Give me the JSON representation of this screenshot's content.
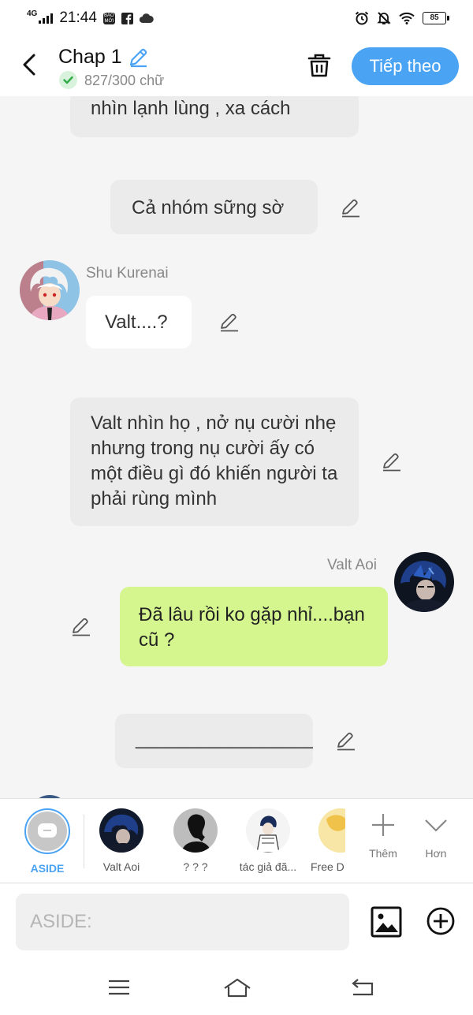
{
  "status_bar": {
    "network": "4G",
    "time": "21:44",
    "app_badge": "BÁO MỚI",
    "battery": "85"
  },
  "header": {
    "title": "Chap 1",
    "word_count": "827/300 chữ",
    "next_label": "Tiếp theo"
  },
  "messages": {
    "narration_1": "nhìn lạnh lùng , xa cách",
    "narration_2": "Cả nhóm sững sờ",
    "shu_name": "Shu Kurenai",
    "shu_text": "Valt....?",
    "narration_3": "Valt nhìn họ , nở nụ cười nhẹ nhưng trong nụ cười ấy có một điều gì đó khiến người ta phải rùng mình",
    "valt_name": "Valt Aoi",
    "valt_text": "Đã lâu rồi ko gặp nhỉ....bạn cũ ?",
    "narration_4": "___________________"
  },
  "characters": [
    {
      "label": "ASIDE"
    },
    {
      "label": "Valt Aoi"
    },
    {
      "label": "? ? ?"
    },
    {
      "label": "tác giả đã..."
    },
    {
      "label": "Free D"
    }
  ],
  "actions": {
    "add_label": "Thêm",
    "more_label": "Hơn"
  },
  "input": {
    "placeholder": "ASIDE:"
  },
  "colors": {
    "accent": "#4aa3f3",
    "player_bubble": "#d5f58f",
    "narration_bubble": "#ebebeb"
  }
}
